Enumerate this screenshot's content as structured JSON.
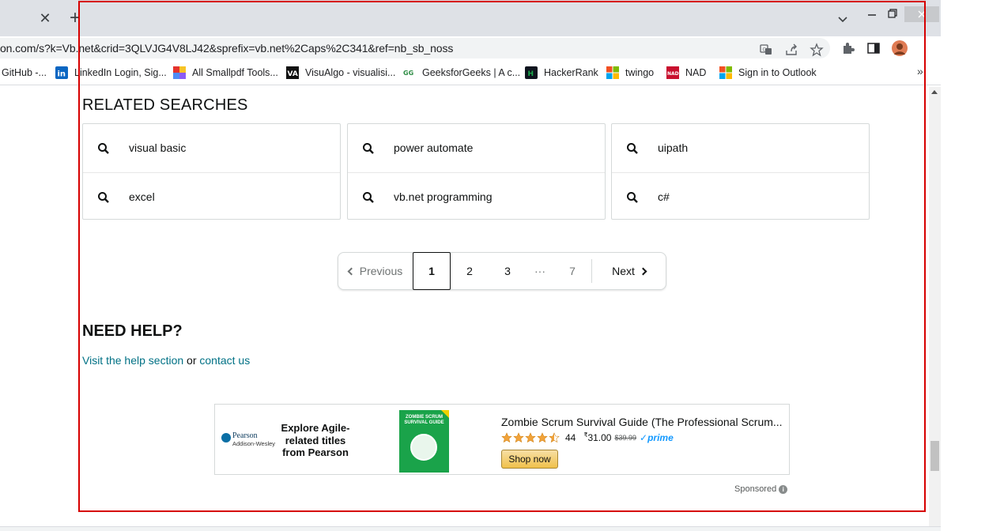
{
  "browser": {
    "url": "on.com/s?k=Vb.net&crid=3QLVJG4V8LJ42&sprefix=vb.net%2Caps%2C341&ref=nb_sb_noss",
    "new_tab_symbol": "+",
    "close_tab_symbol": "✕",
    "bookmarks": [
      {
        "label": "GitHub -...",
        "icon": "github-icon",
        "color": "#24292e"
      },
      {
        "label": "LinkedIn Login, Sig...",
        "icon": "linkedin-icon",
        "color": "#0a66c2"
      },
      {
        "label": "All Smallpdf Tools...",
        "icon": "smallpdf-icon",
        "color": "#e5322d"
      },
      {
        "label": "VisuAlgo - visualisi...",
        "icon": "visualgo-icon",
        "color": "#111111"
      },
      {
        "label": "GeeksforGeeks | A c...",
        "icon": "geeksforgeeks-icon",
        "color": "#2f8d46"
      },
      {
        "label": "HackerRank",
        "icon": "hackerrank-icon",
        "color": "#1ba94c"
      },
      {
        "label": "twingo",
        "icon": "microsoft-icon",
        "color": "#f25022"
      },
      {
        "label": "NAD",
        "icon": "nad-icon",
        "color": "#c8102e"
      },
      {
        "label": "Sign in to Outlook",
        "icon": "microsoft-icon",
        "color": "#f25022"
      }
    ],
    "bookmarks_more": "»"
  },
  "related_searches": {
    "title": "RELATED SEARCHES",
    "columns": [
      [
        "visual basic",
        "excel"
      ],
      [
        "power automate",
        "vb.net programming"
      ],
      [
        "uipath",
        "c#"
      ]
    ]
  },
  "pagination": {
    "previous": "Previous",
    "pages": [
      "1",
      "2",
      "3",
      "7"
    ],
    "ellipsis": "···",
    "next": "Next",
    "current": "1"
  },
  "help": {
    "title": "NEED HELP?",
    "link1": "Visit the help section",
    "joiner": "or",
    "link2": "contact us"
  },
  "ad": {
    "brand": "Pearson",
    "brand_sub": "Addison-Wesley",
    "headline": "Explore Agile-related titles from Pearson",
    "book_cover_text": "ZOMBIE SCRUM SURVIVAL GUIDE",
    "product_title": "Zombie Scrum Survival Guide (The Professional Scrum...",
    "rating_stars": 4.5,
    "rating_count": "44",
    "price_symbol": "₹",
    "price": "31.00",
    "list_price": "$39.99",
    "prime": "prime",
    "button": "Shop now",
    "sponsored": "Sponsored",
    "info_symbol": "i"
  },
  "colors": {
    "link": "#007185",
    "star": "#f1a33b",
    "annotation_frame": "#d60000"
  }
}
